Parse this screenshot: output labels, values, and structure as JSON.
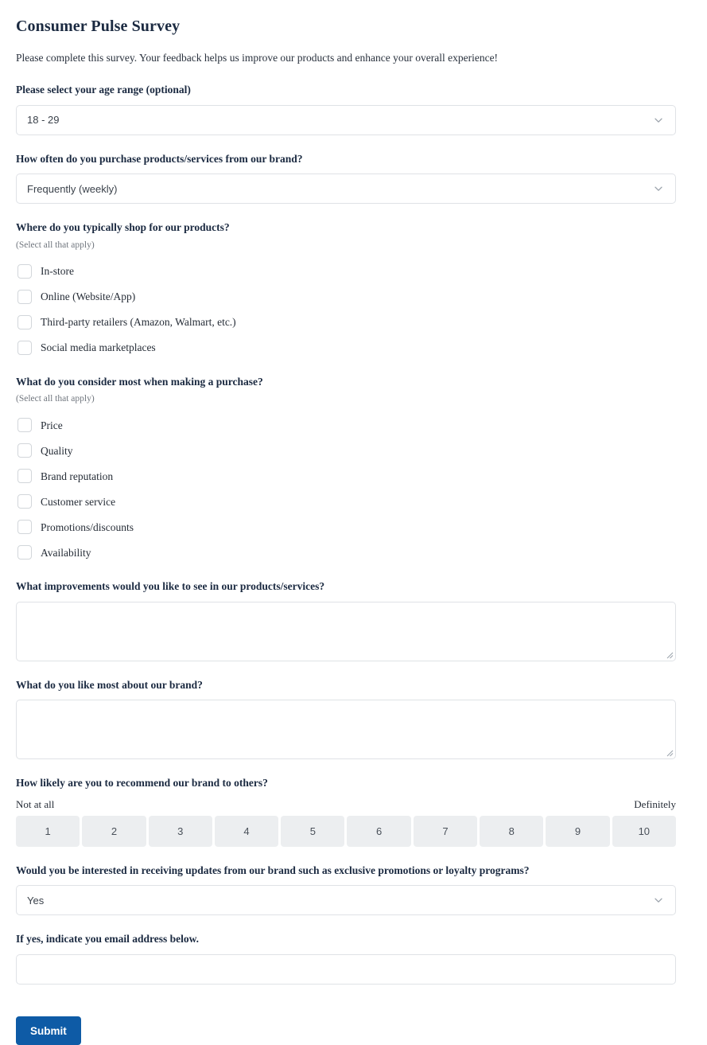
{
  "survey": {
    "title": "Consumer Pulse Survey",
    "intro": "Please complete this survey. Your feedback helps us improve our products and enhance your overall experience!",
    "select_all_hint": "(Select all that apply)",
    "accent_color": "#0e5ba6",
    "scale_cell_color": "#eceef0",
    "border_color": "#dfe2e6"
  },
  "age_question": {
    "label": "Please select your age range (optional)",
    "selected": "18 - 29",
    "chevron_icon": "chevron-down-icon"
  },
  "frequency_question": {
    "label": "How often do you purchase products/services from our brand?",
    "selected": "Frequently (weekly)",
    "chevron_icon": "chevron-down-icon"
  },
  "shop_question": {
    "label": "Where do you typically shop for our products?",
    "hint": "(Select all that apply)",
    "options": [
      {
        "label": "In-store",
        "checked": false
      },
      {
        "label": "Online (Website/App)",
        "checked": false
      },
      {
        "label": "Third-party retailers (Amazon, Walmart, etc.)",
        "checked": false
      },
      {
        "label": "Social media marketplaces",
        "checked": false
      }
    ]
  },
  "consider_question": {
    "label": "What do you consider most when making a purchase?",
    "hint": "(Select all that apply)",
    "options": [
      {
        "label": "Price",
        "checked": false
      },
      {
        "label": "Quality",
        "checked": false
      },
      {
        "label": "Brand reputation",
        "checked": false
      },
      {
        "label": "Customer service",
        "checked": false
      },
      {
        "label": "Promotions/discounts",
        "checked": false
      },
      {
        "label": "Availability",
        "checked": false
      }
    ]
  },
  "improvements_question": {
    "label": "What improvements would you like to see in our products/services?",
    "value": "",
    "placeholder": "",
    "resize_icon": "resize-grip-icon"
  },
  "like_most_question": {
    "label": "What do you like most about our brand?",
    "value": "",
    "placeholder": "",
    "resize_icon": "resize-grip-icon"
  },
  "recommend_question": {
    "label": "How likely are you to recommend our brand to others?",
    "low_end_label": "Not at all",
    "high_end_label": "Definitely",
    "scale": [
      "1",
      "2",
      "3",
      "4",
      "5",
      "6",
      "7",
      "8",
      "9",
      "10"
    ],
    "selected": null
  },
  "updates_question": {
    "label": "Would you be interested in receiving updates from our brand such as exclusive promotions or loyalty programs?",
    "selected": "Yes",
    "chevron_icon": "chevron-down-icon"
  },
  "email_question": {
    "label": "If yes, indicate you email address below.",
    "value": "",
    "placeholder": ""
  },
  "submit": {
    "label": "Submit"
  }
}
